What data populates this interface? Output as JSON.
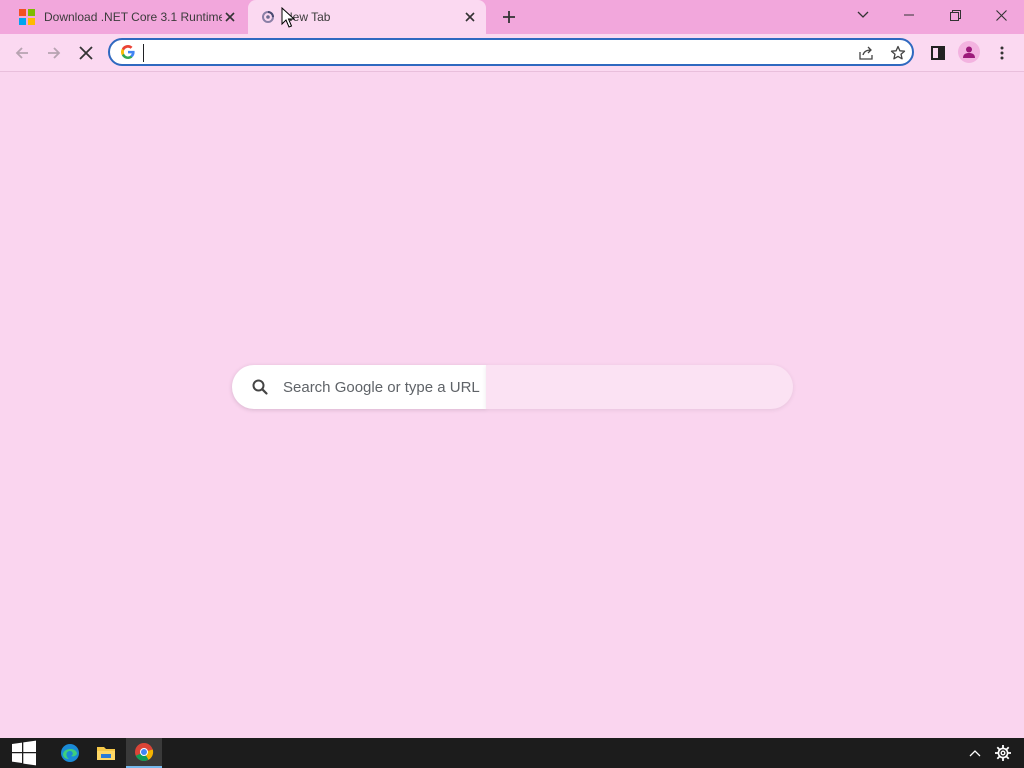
{
  "tabs": [
    {
      "title": "Download .NET Core 3.1 Runtime",
      "active": false,
      "icon": "microsoft-logo-icon"
    },
    {
      "title": "New Tab",
      "active": true,
      "icon": "loading-spinner-icon"
    }
  ],
  "window_controls": {
    "tab_search": "chevron-down-icon",
    "minimize": "minimize-icon",
    "restore": "restore-icon",
    "close": "close-icon"
  },
  "toolbar": {
    "back": "back-arrow-icon",
    "forward": "forward-arrow-icon",
    "stop": "stop-loading-icon",
    "address_value": "",
    "share": "share-icon",
    "bookmark": "star-icon",
    "side_panel": "side-panel-icon",
    "profile": "profile-avatar-icon",
    "menu": "kebab-menu-icon"
  },
  "ntp": {
    "search_placeholder": "Search Google or type a URL"
  },
  "taskbar": {
    "items": [
      "windows-start-icon",
      "edge-icon",
      "file-explorer-icon",
      "chrome-icon"
    ],
    "tray": [
      "chevron-up-icon",
      "gear-icon"
    ]
  },
  "colors": {
    "tab_strip": "#f2a7dc",
    "toolbar": "#fbd9f1",
    "page_background": "#fad5ef",
    "accent": "#2f69c0",
    "taskbar": "#1c1c1c"
  }
}
